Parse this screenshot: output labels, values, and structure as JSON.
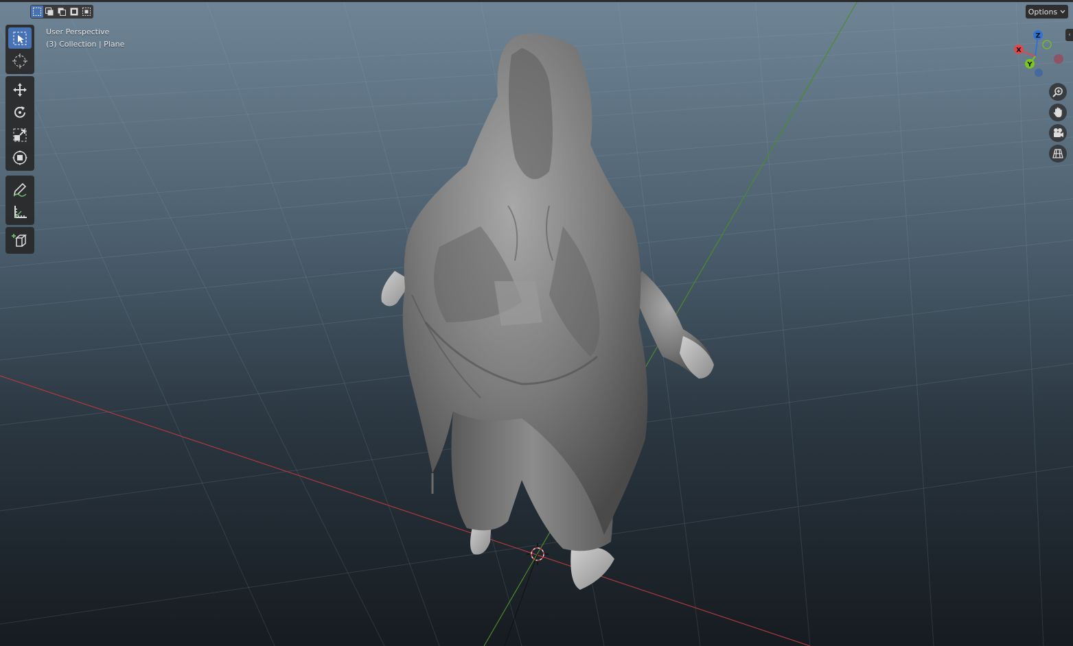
{
  "viewport": {
    "view_name": "User Perspective",
    "collection_line": "(3) Collection | Plane",
    "options_label": "Options"
  },
  "select_modes": [
    {
      "name": "select-mode-new",
      "active": true
    },
    {
      "name": "select-mode-extend",
      "active": false
    },
    {
      "name": "select-mode-subtract",
      "active": false
    },
    {
      "name": "select-mode-invert",
      "active": false
    },
    {
      "name": "select-mode-intersect",
      "active": false
    }
  ],
  "toolbar": {
    "tools": [
      "select-box",
      "cursor",
      "move",
      "rotate",
      "scale",
      "transform",
      "annotate",
      "measure",
      "add-cube"
    ],
    "active_tool": "select-box"
  },
  "gizmo": {
    "axes": [
      {
        "label": "Z",
        "color": "#2f72d6"
      },
      {
        "label": "X",
        "color": "#e0474f"
      },
      {
        "label": "Y",
        "color": "#7ac61d"
      }
    ]
  },
  "nav_buttons": [
    "zoom-icon",
    "hand-pan-icon",
    "camera-view-icon",
    "ortho-grid-icon"
  ],
  "colors": {
    "accent": "#4772b3",
    "x_axis": "#b03a3a",
    "y_axis": "#4e8a2a"
  }
}
